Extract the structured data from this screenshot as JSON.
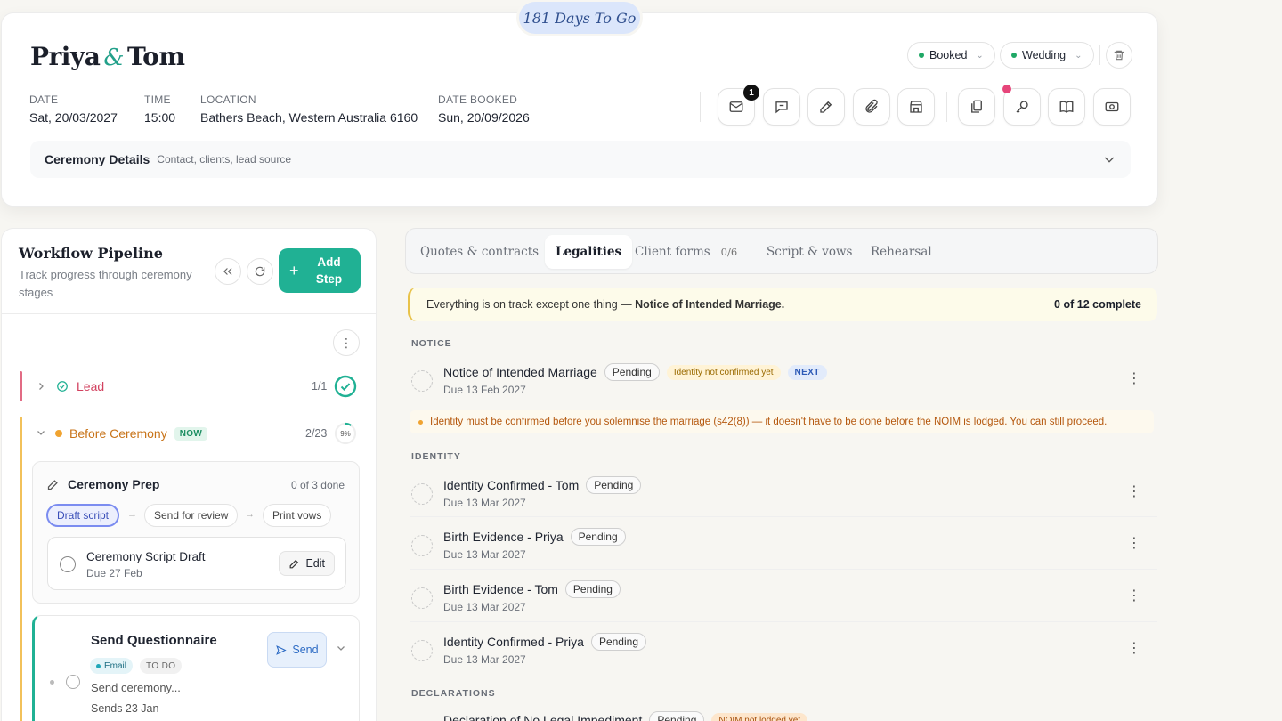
{
  "countdown": "181 Days To Go",
  "couple": {
    "first": "Priya",
    "amp": "&",
    "second": "Tom"
  },
  "meta": [
    {
      "label": "DATE",
      "value": "Sat, 20/03/2027"
    },
    {
      "label": "TIME",
      "value": "15:00"
    },
    {
      "label": "LOCATION",
      "value": "Bathers Beach, Western Australia 6160"
    },
    {
      "label": "DATE BOOKED",
      "value": "Sun, 20/09/2026"
    }
  ],
  "status_dropdown": {
    "value": "Booked",
    "color": "#1fa866"
  },
  "type_dropdown": {
    "value": "Wedding",
    "color": "#1fa866"
  },
  "toolbar": {
    "mail_badge": "1"
  },
  "ceremony_details": {
    "title": "Ceremony Details",
    "subtitle": "Contact, clients, lead source"
  },
  "workflow": {
    "title": "Workflow Pipeline",
    "subtitle": "Track progress through ceremony stages",
    "add_step": "Add Step",
    "stages": [
      {
        "name": "Lead",
        "count": "1/1",
        "color": "#d2415f"
      },
      {
        "name": "Before Ceremony",
        "tag": "NOW",
        "count": "2/23",
        "percent": "9%",
        "color": "#c8741a"
      }
    ],
    "prep": {
      "title": "Ceremony Prep",
      "done": "0 of 3 done",
      "chips": [
        "Draft script",
        "Send for review",
        "Print vows"
      ],
      "task": {
        "title": "Ceremony Script Draft",
        "due": "Due 27 Feb",
        "edit": "Edit"
      }
    },
    "questionnaire": {
      "title": "Send Questionnaire",
      "tag_email": "Email",
      "tag_todo": "TO DO",
      "desc": "Send ceremony...",
      "sends": "Sends 23 Jan",
      "send": "Send"
    }
  },
  "tabs": [
    {
      "label": "Quotes & contracts"
    },
    {
      "label": "Legalities",
      "active": true
    },
    {
      "label": "Client forms",
      "count": "0/6"
    },
    {
      "label": "Script & vows"
    },
    {
      "label": "Rehearsal"
    }
  ],
  "banner": {
    "text": "Everything is on track except one thing — ",
    "bold": "Notice of Intended Marriage.",
    "progress": "0 of 12 complete"
  },
  "sections": {
    "notice": "NOTICE",
    "identity": "IDENTITY",
    "declarations": "DECLARATIONS"
  },
  "items": [
    {
      "title": "Notice of Intended Marriage",
      "status": "Pending",
      "tag": "Identity not confirmed yet",
      "tag2": "NEXT",
      "due": "Due 13 Feb 2027"
    },
    {
      "title": "Identity Confirmed - Tom",
      "status": "Pending",
      "due": "Due 13 Mar 2027"
    },
    {
      "title": "Birth Evidence - Priya",
      "status": "Pending",
      "due": "Due 13 Mar 2027"
    },
    {
      "title": "Birth Evidence - Tom",
      "status": "Pending",
      "due": "Due 13 Mar 2027"
    },
    {
      "title": "Identity Confirmed - Priya",
      "status": "Pending",
      "due": "Due 13 Mar 2027"
    },
    {
      "title": "Declaration of No Legal Impediment",
      "status": "Pending",
      "tag": "NOIM not lodged yet"
    }
  ],
  "warning": "Identity must be confirmed before you solemnise the marriage (s42(8)) — it doesn't have to be done before the NOIM is lodged. You can still proceed."
}
